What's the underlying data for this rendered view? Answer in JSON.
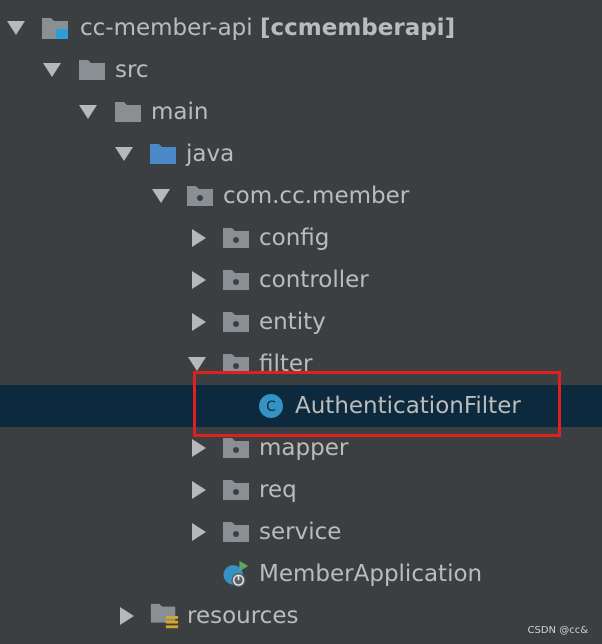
{
  "tree": {
    "root": {
      "name": "cc-member-api",
      "module": "[ccmemberapi]"
    },
    "src": "src",
    "main": "main",
    "java": "java",
    "package": "com.cc.member",
    "config": "config",
    "controller": "controller",
    "entity": "entity",
    "filter": "filter",
    "auth_filter": "AuthenticationFilter",
    "class_letter": "C",
    "mapper": "mapper",
    "req": "req",
    "service": "service",
    "member_app": "MemberApplication",
    "resources": "resources"
  },
  "colors": {
    "background": "#3c3f41",
    "selection": "#0d293e",
    "highlight_border": "#e02020",
    "folder": "#8a8f93",
    "source_folder": "#4a88c7",
    "class_icon": "#3592c4",
    "run_badge": "#59a869"
  },
  "icons": {
    "expanded": "triangle-down-icon",
    "collapsed": "triangle-right-icon",
    "folder": "folder-icon",
    "package": "package-icon",
    "class": "class-icon",
    "spring_boot": "spring-boot-application-icon",
    "resources": "resources-folder-icon"
  },
  "watermark": "CSDN @cc&"
}
